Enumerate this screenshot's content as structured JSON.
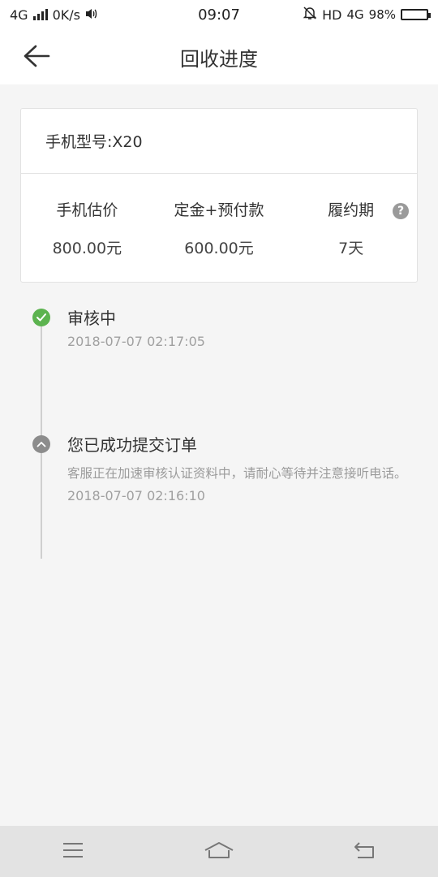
{
  "status_bar": {
    "network": "4G",
    "speed": "0K/s",
    "time": "09:07",
    "hd": "HD",
    "network_right": "4G",
    "battery": "98%"
  },
  "header": {
    "title": "回收进度"
  },
  "card": {
    "model": "手机型号:X20",
    "stats": [
      {
        "label": "手机估价",
        "value": "800.00元"
      },
      {
        "label": "定金+预付款",
        "value": "600.00元"
      },
      {
        "label": "履约期",
        "value": "7天"
      }
    ],
    "help_glyph": "?"
  },
  "timeline": [
    {
      "title": "审核中",
      "time": "2018-07-07 02:17:05",
      "status": "done"
    },
    {
      "title": "您已成功提交订单",
      "desc": "客服正在加速审核认证资料中，请耐心等待并注意接听电话。",
      "time": "2018-07-07 02:16:10",
      "status": "past"
    }
  ],
  "colors": {
    "accent_green": "#5cb34f",
    "past_gray": "#8c8c8c"
  },
  "icons": {
    "back": "arrow-left-icon",
    "help": "question-mark-icon",
    "check": "check-icon",
    "up": "chevron-up-icon",
    "menu": "menu-icon",
    "home": "home-icon",
    "return": "return-icon"
  }
}
